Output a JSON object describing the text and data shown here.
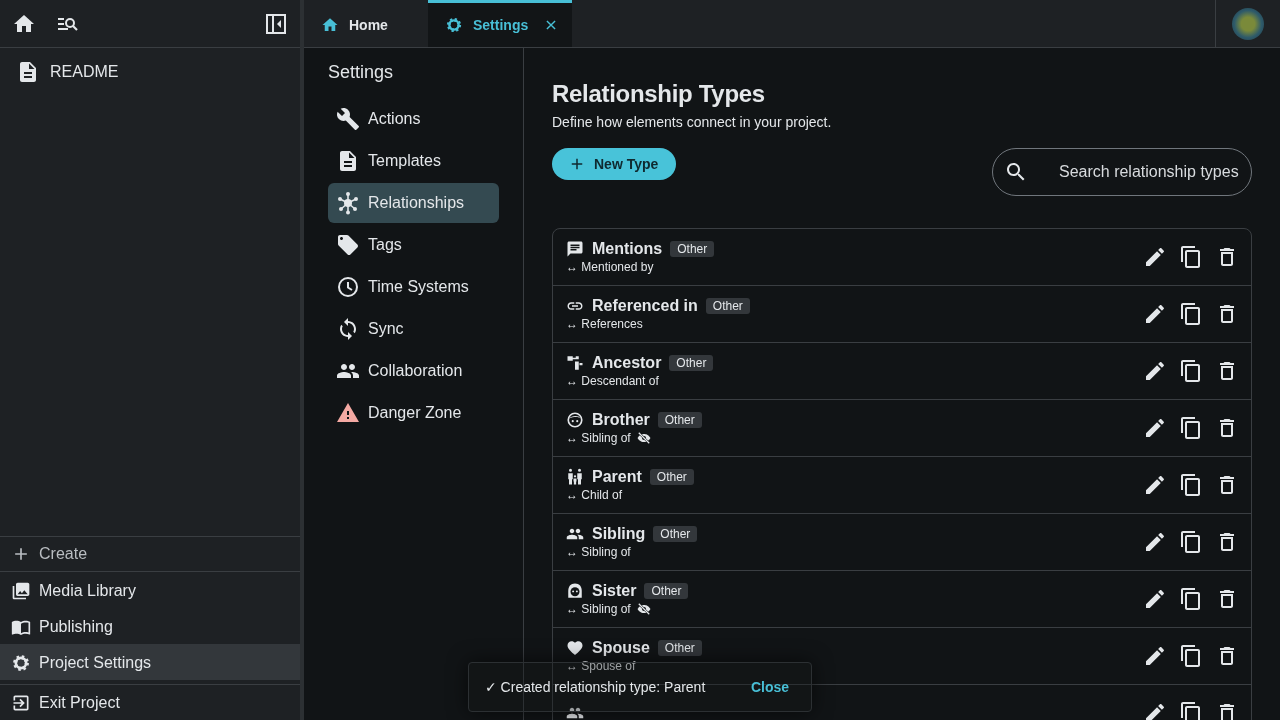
{
  "sidebar": {
    "documents": [
      {
        "label": "README",
        "selected": false
      }
    ],
    "footer": [
      {
        "label": "Create",
        "kind": "create",
        "selected": false
      },
      {
        "label": "Media Library",
        "kind": "media",
        "selected": false
      },
      {
        "label": "Publishing",
        "kind": "publishing",
        "selected": false
      },
      {
        "label": "Project Settings",
        "kind": "settings",
        "selected": true
      },
      {
        "label": "Exit Project",
        "kind": "exit",
        "selected": false
      }
    ]
  },
  "tabs": [
    {
      "label": "Home",
      "kind": "home",
      "selected": false,
      "closable": false
    },
    {
      "label": "Settings",
      "kind": "settings",
      "selected": true,
      "closable": true
    }
  ],
  "settings_nav": {
    "title": "Settings",
    "items": [
      {
        "label": "Actions",
        "kind": "actions",
        "selected": false
      },
      {
        "label": "Templates",
        "kind": "templates",
        "selected": false
      },
      {
        "label": "Relationships",
        "kind": "relationships",
        "selected": true
      },
      {
        "label": "Tags",
        "kind": "tags",
        "selected": false
      },
      {
        "label": "Time Systems",
        "kind": "time",
        "selected": false
      },
      {
        "label": "Sync",
        "kind": "sync",
        "selected": false
      },
      {
        "label": "Collaboration",
        "kind": "collaboration",
        "selected": false
      },
      {
        "label": "Danger Zone",
        "kind": "danger",
        "selected": false
      }
    ]
  },
  "page": {
    "title": "Relationship Types",
    "subtitle": "Define how elements connect in your project.",
    "new_button": "New Type",
    "search": {
      "placeholder": "Search relationship types"
    }
  },
  "types": [
    {
      "name": "Mentions",
      "kind": "chat",
      "badge": "Other",
      "inverse": "↔ Mentioned by",
      "hidden": false
    },
    {
      "name": "Referenced in",
      "kind": "link",
      "badge": "Other",
      "inverse": "↔ References",
      "hidden": false
    },
    {
      "name": "Ancestor",
      "kind": "tree",
      "badge": "Other",
      "inverse": "↔ Descendant of",
      "hidden": false
    },
    {
      "name": "Brother",
      "kind": "face",
      "badge": "Other",
      "inverse": "↔ Sibling of",
      "hidden": true
    },
    {
      "name": "Parent",
      "kind": "family",
      "badge": "Other",
      "inverse": "↔ Child of",
      "hidden": false
    },
    {
      "name": "Sibling",
      "kind": "people",
      "badge": "Other",
      "inverse": "↔ Sibling of",
      "hidden": false
    },
    {
      "name": "Sister",
      "kind": "face2",
      "badge": "Other",
      "inverse": "↔ Sibling of",
      "hidden": true
    },
    {
      "name": "Spouse",
      "kind": "heart",
      "badge": "Other",
      "inverse": "↔ Spouse of",
      "hidden": false
    },
    {
      "kind": "people",
      "hidden": false
    }
  ],
  "toast": {
    "message": "✓ Created relationship type: Parent",
    "action": "Close"
  }
}
